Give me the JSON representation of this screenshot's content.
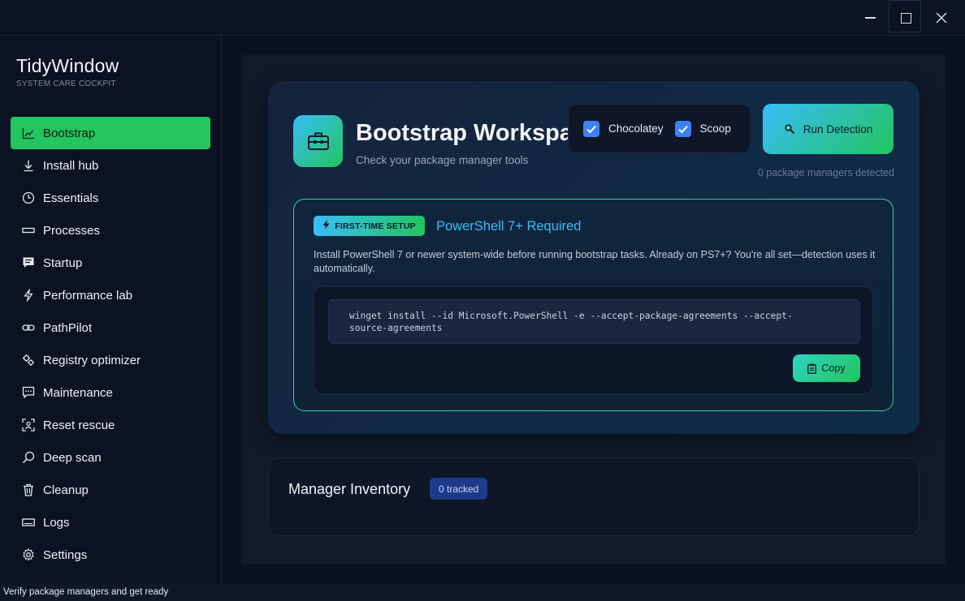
{
  "window": {
    "min_icon": "minimize-icon",
    "max_icon": "maximize-icon",
    "close_icon": "close-icon"
  },
  "brand": {
    "title": "TidyWindow",
    "subtitle": "SYSTEM CARE COCKPIT"
  },
  "sidebar": {
    "items": [
      {
        "label": "Bootstrap",
        "icon": "chart-icon",
        "active": true
      },
      {
        "label": "Install hub",
        "icon": "download-icon"
      },
      {
        "label": "Essentials",
        "icon": "clock-icon"
      },
      {
        "label": "Processes",
        "icon": "rectangle-icon"
      },
      {
        "label": "Startup",
        "icon": "message-icon"
      },
      {
        "label": "Performance lab",
        "icon": "lightning-icon"
      },
      {
        "label": "PathPilot",
        "icon": "link-icon"
      },
      {
        "label": "Registry optimizer",
        "icon": "gears-icon"
      },
      {
        "label": "Maintenance",
        "icon": "chat-icon"
      },
      {
        "label": "Reset rescue",
        "icon": "person-scan-icon"
      },
      {
        "label": "Deep scan",
        "icon": "search-icon"
      },
      {
        "label": "Cleanup",
        "icon": "trash-icon"
      },
      {
        "label": "Logs",
        "icon": "keyboard-icon"
      },
      {
        "label": "Settings",
        "icon": "gear-icon"
      }
    ]
  },
  "hero": {
    "title": "Bootstrap Workspace",
    "subtitle": "Check your package manager tools",
    "icon": "toolbox-icon",
    "managers": [
      {
        "label": "Chocolatey",
        "checked": true
      },
      {
        "label": "Scoop",
        "checked": true
      }
    ],
    "run_button": "Run Detection",
    "detected_text": "0 package managers detected"
  },
  "powershell": {
    "badge": "FIRST-TIME SETUP",
    "title": "PowerShell 7+ Required",
    "description": "Install PowerShell 7 or newer system-wide before running bootstrap tasks. Already on PS7+? You're all set—detection uses it automatically.",
    "command_line1": "winget install --id Microsoft.PowerShell -e --accept-package-agreements --accept-",
    "command_line2": "source-agreements",
    "copy_button": "Copy"
  },
  "inventory": {
    "title": "Manager Inventory",
    "badge": "0 tracked"
  },
  "status": {
    "text": "Verify package managers and get ready"
  },
  "colors": {
    "accent_green": "#22c55e",
    "accent_blue": "#38bdf8",
    "background": "#0b1120"
  }
}
